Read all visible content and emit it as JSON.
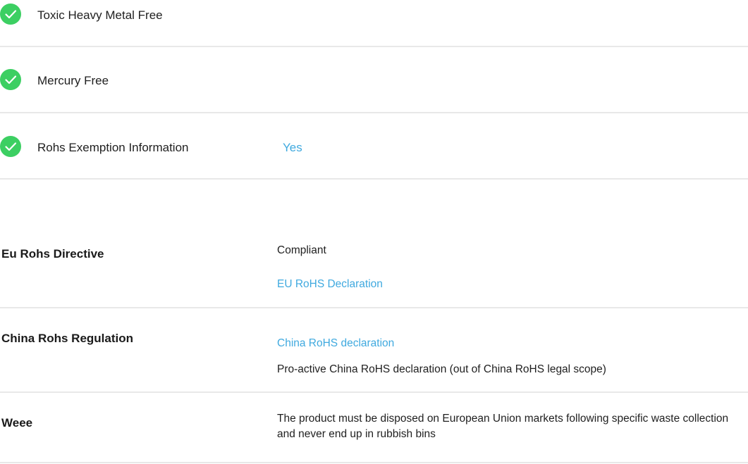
{
  "environmental_features": [
    {
      "label": "Toxic Heavy Metal Free",
      "value": "",
      "icon": "check-circle-icon"
    },
    {
      "label": "Mercury Free",
      "value": "",
      "icon": "check-circle-icon"
    },
    {
      "label": "Rohs Exemption Information",
      "value": "Yes",
      "icon": "check-circle-icon"
    }
  ],
  "regulations": {
    "eu_rohs": {
      "label": "Eu Rohs Directive",
      "status": "Compliant",
      "link": "EU RoHS Declaration"
    },
    "china_rohs": {
      "label": "China Rohs Regulation",
      "link": "China RoHS declaration",
      "note": "Pro-active China RoHS declaration (out of China RoHS legal scope)"
    },
    "weee": {
      "label": "Weee",
      "text": "The product must be disposed on European Union markets following specific waste collection and never end up in rubbish bins"
    }
  },
  "colors": {
    "check_green": "#3ccf62",
    "link_blue": "#3fa9df",
    "divider": "#e8e8e8"
  }
}
